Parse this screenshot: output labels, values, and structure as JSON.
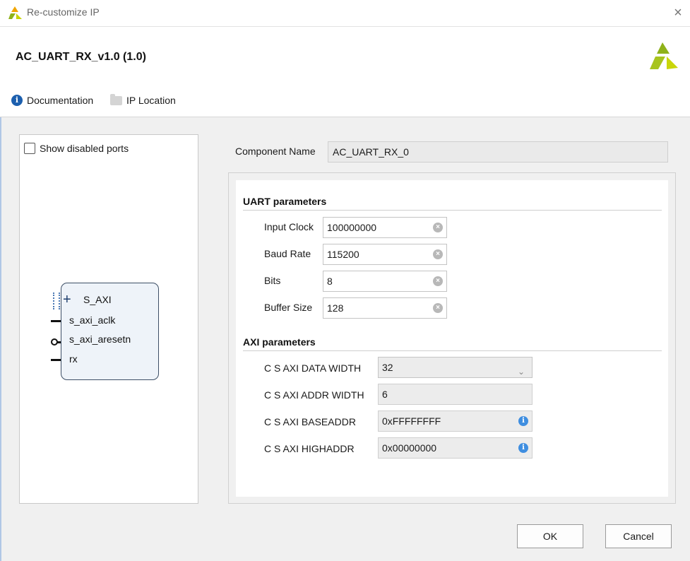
{
  "window": {
    "title": "Re-customize IP",
    "close_glyph": "×"
  },
  "header": {
    "ip_title": "AC_UART_RX_v1.0 (1.0)",
    "documentation_label": "Documentation",
    "ip_location_label": "IP Location",
    "brand_color": "#8fb21a"
  },
  "left_panel": {
    "show_disabled_ports_label": "Show disabled ports",
    "show_disabled_ports_checked": false,
    "block": {
      "bus_port": "S_AXI",
      "ports": [
        "s_axi_aclk",
        "s_axi_aresetn",
        "rx"
      ]
    }
  },
  "component": {
    "label": "Component Name",
    "value": "AC_UART_RX_0"
  },
  "uart": {
    "title": "UART parameters",
    "params": [
      {
        "label": "Input Clock",
        "value": "100000000"
      },
      {
        "label": "Baud Rate",
        "value": "115200"
      },
      {
        "label": "Bits",
        "value": "8"
      },
      {
        "label": "Buffer Size",
        "value": "128"
      }
    ]
  },
  "axi": {
    "title": "AXI parameters",
    "data_width": {
      "label": "C S AXI DATA WIDTH",
      "value": "32"
    },
    "addr_width": {
      "label": "C S AXI ADDR WIDTH",
      "value": "6"
    },
    "baseaddr": {
      "label": "C S AXI BASEADDR",
      "value": "0xFFFFFFFF"
    },
    "highaddr": {
      "label": "C S AXI HIGHADDR",
      "value": "0x00000000"
    }
  },
  "footer": {
    "ok_label": "OK",
    "cancel_label": "Cancel"
  }
}
